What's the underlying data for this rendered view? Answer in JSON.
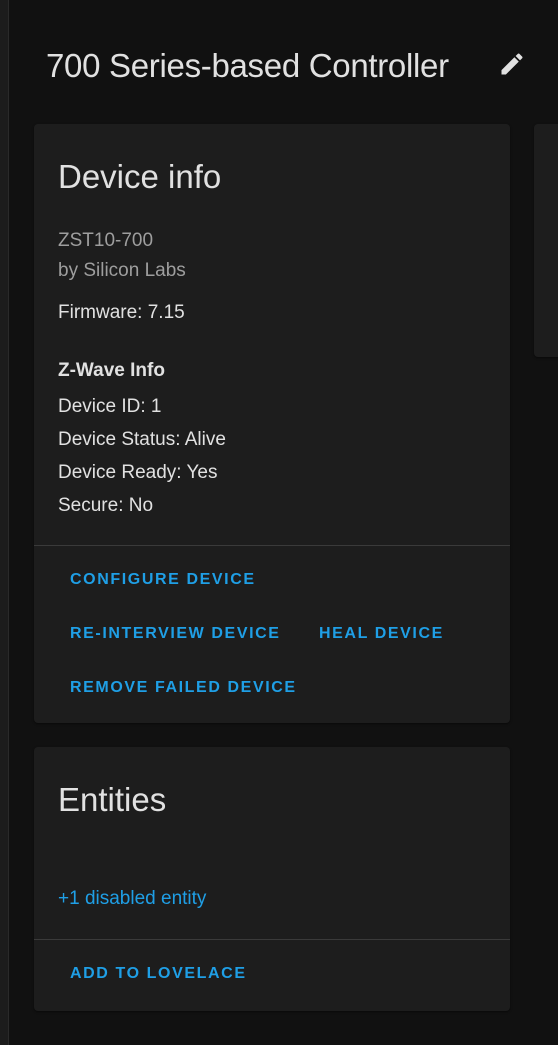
{
  "header": {
    "title": "700 Series-based Controller",
    "edit_icon": "pencil-icon"
  },
  "device_info": {
    "title": "Device info",
    "model": "ZST10-700",
    "manufacturer": "by Silicon Labs",
    "firmware": "Firmware: 7.15",
    "zwave_heading": "Z-Wave Info",
    "device_id": "Device ID: 1",
    "device_status": "Device Status: Alive",
    "device_ready": "Device Ready: Yes",
    "secure": "Secure: No",
    "actions": {
      "configure": "CONFIGURE DEVICE",
      "reinterview": "RE-INTERVIEW DEVICE",
      "heal": "HEAL DEVICE",
      "remove_failed": "REMOVE FAILED DEVICE"
    }
  },
  "entities": {
    "title": "Entities",
    "disabled_link": "+1 disabled entity",
    "add_to_lovelace": "ADD TO LOVELACE"
  },
  "colors": {
    "background": "#111111",
    "card": "#1d1d1d",
    "accent": "#1f9fe6",
    "text": "#e1e1e1",
    "muted": "#9e9e9e"
  }
}
